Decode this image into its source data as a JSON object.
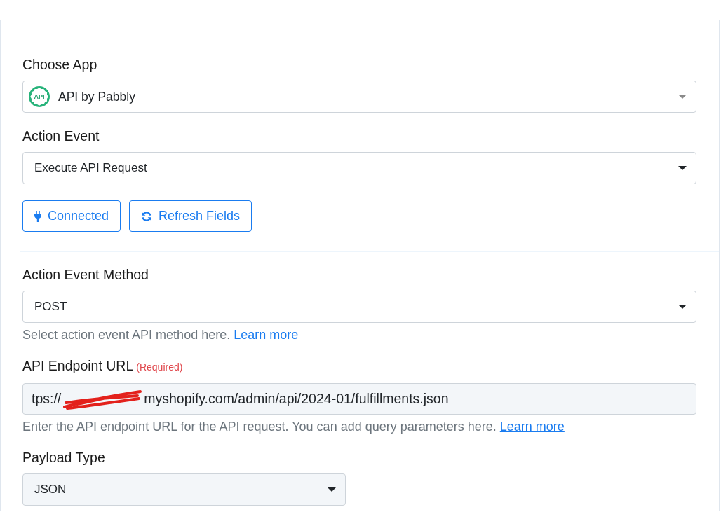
{
  "sections": [
    {
      "fields": [
        {
          "kind": "app_select",
          "label": "Choose App",
          "app_icon_text": "API",
          "value": "API by Pabbly"
        },
        {
          "kind": "select",
          "label": "Action Event",
          "value": "Execute API Request"
        }
      ],
      "buttons": [
        {
          "label": "Connected"
        },
        {
          "label": "Refresh Fields"
        }
      ]
    },
    {
      "fields": [
        {
          "kind": "select",
          "label": "Action Event Method",
          "value": "POST",
          "help": "Select action event API method here.",
          "help_link": "Learn more"
        },
        {
          "kind": "url_field",
          "label": "API Endpoint URL",
          "required_note": "(Required)",
          "value_start": "tps://",
          "redacted": true,
          "value_end": "myshopify.com/admin/api/2024-01/fulfillments.json",
          "help": "Enter the API endpoint URL for the API request. You can add query parameters here.",
          "help_link": "Learn more"
        },
        {
          "kind": "compact_select",
          "label": "Payload Type",
          "value": "JSON"
        }
      ]
    }
  ]
}
